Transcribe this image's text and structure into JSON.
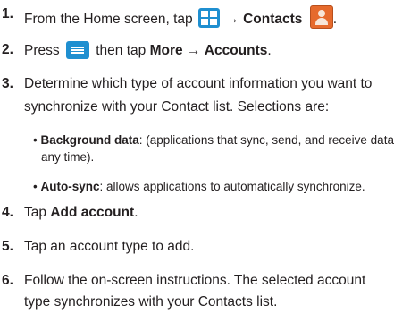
{
  "steps": [
    {
      "number": "1.",
      "part_a": "From the Home screen, tap",
      "arrow": "→",
      "bold": "Contacts",
      "home_icon": "apps-grid-icon",
      "contacts_icon": "contacts-icon"
    },
    {
      "number": "2.",
      "part_a": "Press",
      "part_b": "then tap",
      "bold_a": "More",
      "arrow": "→",
      "bold_b": "Accounts",
      "suffix": ".",
      "menu_icon": "menu-key-icon"
    },
    {
      "number": "3.",
      "line1": "Determine which type of account information you want to",
      "line2": "synchronize with your Contact list. Selections are:",
      "bullets": [
        {
          "bullet": "•",
          "bold": "Background data",
          "text1": ": (applications that sync, send, and receive data",
          "text2": "any time)."
        },
        {
          "bullet": "•",
          "bold": "Auto-sync",
          "text1": ": allows applications to automatically synchronize."
        }
      ]
    },
    {
      "number": "4.",
      "prefix": "Tap",
      "bold": "Add account",
      "suffix": "."
    },
    {
      "number": "5.",
      "text": "Tap an account type to add."
    },
    {
      "number": "6.",
      "line1": "Follow the on-screen instructions. The selected account",
      "line2": "type synchronizes with your Contacts list."
    }
  ],
  "colors": {
    "text": "#231f20",
    "icon_blue": "#1f8fd0",
    "contacts_orange": "#e66a2c"
  }
}
